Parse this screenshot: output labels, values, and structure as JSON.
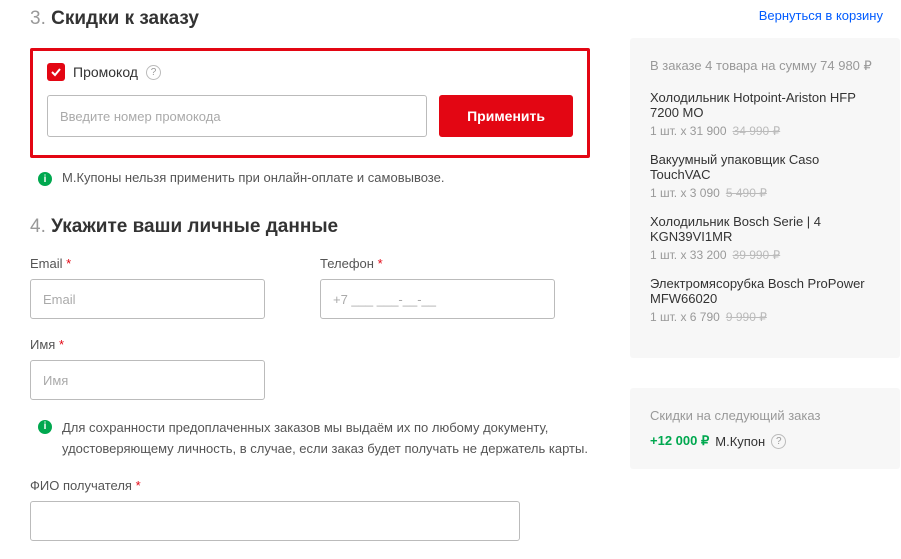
{
  "back_link": "Вернуться в корзину",
  "section3": {
    "num": "3.",
    "title": "Скидки к заказу",
    "promo_label": "Промокод",
    "input_placeholder": "Введите номер промокода",
    "apply_label": "Применить",
    "warning": "М.Купоны нельзя применить при онлайн-оплате и самовывозе."
  },
  "section4": {
    "num": "4.",
    "title": "Укажите ваши личные данные",
    "email_label": "Email",
    "email_placeholder": "Email",
    "phone_label": "Телефон",
    "phone_placeholder": "+7 ___ ___-__-__",
    "name_label": "Имя",
    "name_placeholder": "Имя",
    "info_text": "Для сохранности предоплаченных заказов мы выдаём их по любому документу, удостоверяющему личность, в случае, если заказ будет получать не держатель карты.",
    "recipient_label": "ФИО получателя"
  },
  "order": {
    "summary_title": "В заказе 4 товара на сумму 74 980 ₽",
    "items": [
      {
        "name": "Холодильник Hotpoint-Ariston HFP 7200 MO",
        "qty_price": "1 шт. x 31 900",
        "old": "34 990 ₽"
      },
      {
        "name": "Вакуумный упаковщик Caso TouchVAC",
        "qty_price": "1 шт. x 3 090",
        "old": "5 490 ₽"
      },
      {
        "name": "Холодильник Bosch Serie | 4 KGN39VI1MR",
        "qty_price": "1 шт. x 33 200",
        "old": "39 990 ₽"
      },
      {
        "name": "Электромясорубка Bosch ProPower MFW66020",
        "qty_price": "1 шт. x 6 790",
        "old": "9 990 ₽"
      }
    ]
  },
  "coupons": {
    "title": "Скидки на следующий заказ",
    "amount": "+12 000 ₽",
    "label": "М.Купон"
  }
}
